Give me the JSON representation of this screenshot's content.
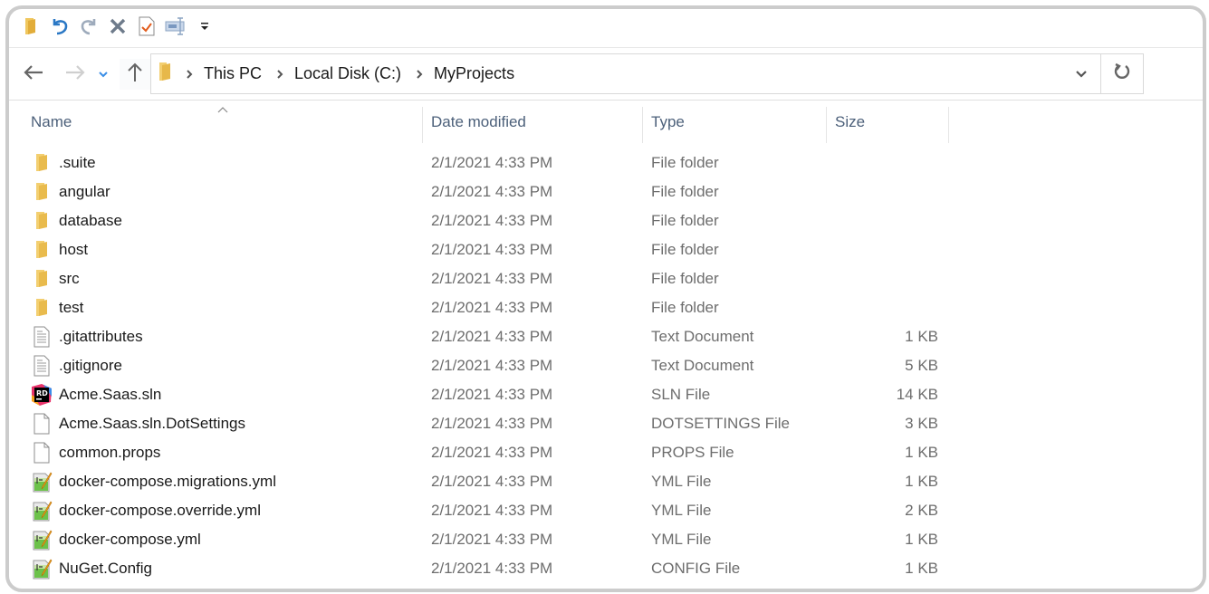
{
  "quick_access": {
    "icons": [
      "folder-icon",
      "undo-icon",
      "redo-icon",
      "delete-icon",
      "properties-icon",
      "rename-icon",
      "customize-dropdown-icon"
    ]
  },
  "navigation": {
    "back": "back-arrow-icon",
    "forward": "forward-arrow-icon",
    "recent": "recent-locations-icon",
    "up": "up-arrow-icon"
  },
  "address_bar": {
    "breadcrumbs": [
      "This PC",
      "Local Disk (C:)",
      "MyProjects"
    ]
  },
  "columns": {
    "name": "Name",
    "date": "Date modified",
    "type": "Type",
    "size": "Size"
  },
  "files": [
    {
      "name": ".suite",
      "date": "2/1/2021 4:33 PM",
      "type": "File folder",
      "size": "",
      "icon": "folder"
    },
    {
      "name": "angular",
      "date": "2/1/2021 4:33 PM",
      "type": "File folder",
      "size": "",
      "icon": "folder"
    },
    {
      "name": "database",
      "date": "2/1/2021 4:33 PM",
      "type": "File folder",
      "size": "",
      "icon": "folder"
    },
    {
      "name": "host",
      "date": "2/1/2021 4:33 PM",
      "type": "File folder",
      "size": "",
      "icon": "folder"
    },
    {
      "name": "src",
      "date": "2/1/2021 4:33 PM",
      "type": "File folder",
      "size": "",
      "icon": "folder"
    },
    {
      "name": "test",
      "date": "2/1/2021 4:33 PM",
      "type": "File folder",
      "size": "",
      "icon": "folder"
    },
    {
      "name": ".gitattributes",
      "date": "2/1/2021 4:33 PM",
      "type": "Text Document",
      "size": "1 KB",
      "icon": "text"
    },
    {
      "name": ".gitignore",
      "date": "2/1/2021 4:33 PM",
      "type": "Text Document",
      "size": "5 KB",
      "icon": "text"
    },
    {
      "name": "Acme.Saas.sln",
      "date": "2/1/2021 4:33 PM",
      "type": "SLN File",
      "size": "14 KB",
      "icon": "rider"
    },
    {
      "name": "Acme.Saas.sln.DotSettings",
      "date": "2/1/2021 4:33 PM",
      "type": "DOTSETTINGS File",
      "size": "3 KB",
      "icon": "blank"
    },
    {
      "name": "common.props",
      "date": "2/1/2021 4:33 PM",
      "type": "PROPS File",
      "size": "1 KB",
      "icon": "blank"
    },
    {
      "name": "docker-compose.migrations.yml",
      "date": "2/1/2021 4:33 PM",
      "type": "YML File",
      "size": "1 KB",
      "icon": "yml"
    },
    {
      "name": "docker-compose.override.yml",
      "date": "2/1/2021 4:33 PM",
      "type": "YML File",
      "size": "2 KB",
      "icon": "yml"
    },
    {
      "name": "docker-compose.yml",
      "date": "2/1/2021 4:33 PM",
      "type": "YML File",
      "size": "1 KB",
      "icon": "yml"
    },
    {
      "name": "NuGet.Config",
      "date": "2/1/2021 4:33 PM",
      "type": "CONFIG File",
      "size": "1 KB",
      "icon": "yml"
    }
  ],
  "colors": {
    "header_text": "#4c607a",
    "detail_text": "#6d6d6d",
    "folder": "#f5c542",
    "accent_blue": "#2b78c5"
  }
}
